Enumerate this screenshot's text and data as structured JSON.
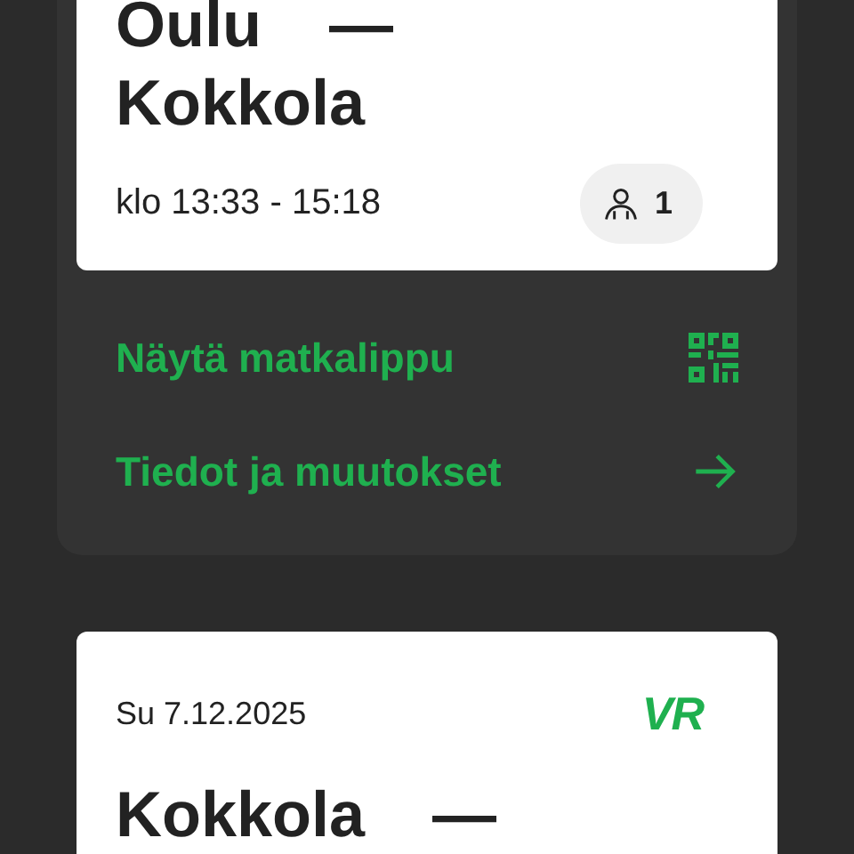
{
  "trips": [
    {
      "from": "Oulu",
      "separator": "—",
      "to": "Kokkola",
      "time": "klo 13:33 - 15:18",
      "passengers": "1",
      "actions": [
        {
          "label": "Näytä matkalippu",
          "kind": "qr"
        },
        {
          "label": "Tiedot ja muutokset",
          "kind": "arrow"
        }
      ]
    },
    {
      "date": "Su 7.12.2025",
      "logo": "VR",
      "from": "Kokkola",
      "separator": "—"
    }
  ]
}
